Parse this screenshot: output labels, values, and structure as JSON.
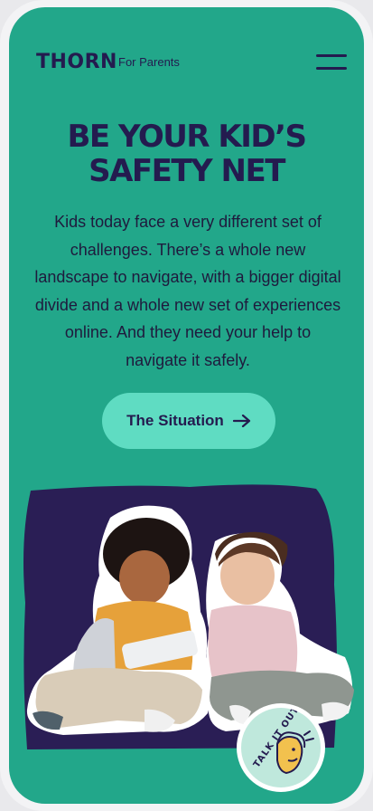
{
  "header": {
    "logo": "THORN",
    "tagline": "For Parents",
    "menu_icon": "hamburger-menu-icon"
  },
  "hero": {
    "headline_line1": "BE YOUR KID’S",
    "headline_line2": "SAFETY NET",
    "body": "Kids today face a very different set of challenges. There’s a whole new landscape to navigate, with a bigger digital divide and a whole new set of experiences online. And they need your help to navigate it safely.",
    "cta_label": "The Situation",
    "cta_icon": "arrow-right-icon",
    "badge_text": "TALK IT OUT"
  },
  "colors": {
    "background": "#22a78a",
    "navy": "#241b4f",
    "button": "#5fdcc2",
    "image_backdrop": "#2a1e55"
  }
}
